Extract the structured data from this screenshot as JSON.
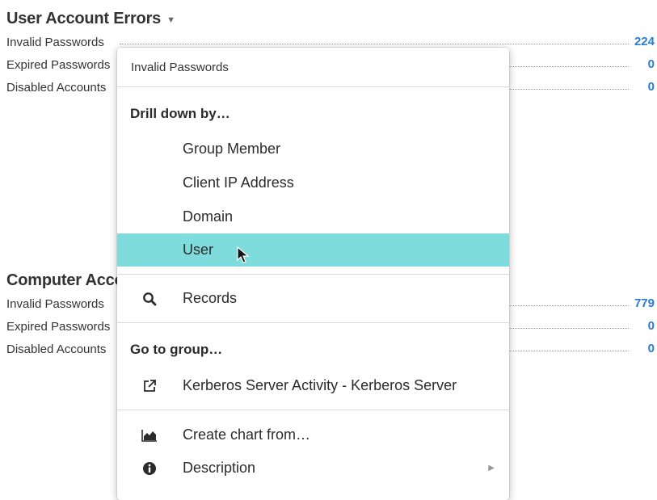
{
  "sections": [
    {
      "title": "User Account Errors",
      "rows": [
        {
          "label": "Invalid Passwords",
          "value": "224"
        },
        {
          "label": "Expired Passwords",
          "value": "0"
        },
        {
          "label": "Disabled Accounts",
          "value": "0"
        }
      ]
    },
    {
      "title": "Computer Account Errors",
      "rows": [
        {
          "label": "Invalid Passwords",
          "value": "779"
        },
        {
          "label": "Expired Passwords",
          "value": "0"
        },
        {
          "label": "Disabled Accounts",
          "value": "0"
        }
      ]
    }
  ],
  "menu": {
    "header": "Invalid Passwords",
    "drill_heading": "Drill down by…",
    "drill_options": [
      "Group Member",
      "Client IP Address",
      "Domain",
      "User"
    ],
    "highlighted": "User",
    "records": "Records",
    "goto_heading": "Go to group…",
    "goto_link": "Kerberos Server Activity - Kerberos Server",
    "create_chart": "Create chart from…",
    "description": "Description"
  },
  "colors": {
    "highlight": "#7fdcdd",
    "value_link": "#2a7ccf"
  },
  "icons": {
    "records": "search-icon",
    "goto": "external-link-icon",
    "create_chart": "area-chart-icon",
    "description": "info-icon",
    "title_caret": "caret-down-icon",
    "submenu": "chevron-right-icon",
    "cursor": "mouse-pointer-icon"
  }
}
